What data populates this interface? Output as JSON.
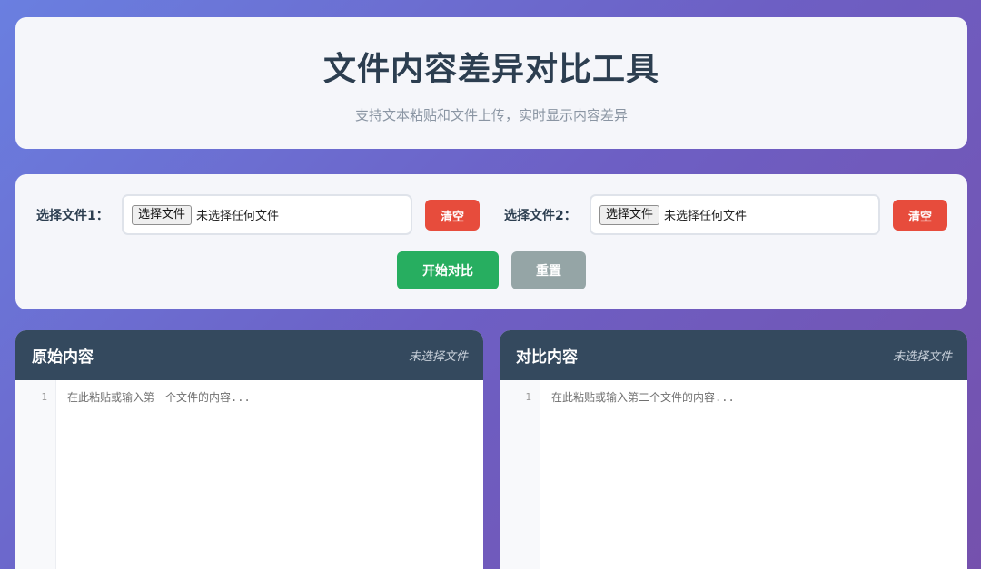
{
  "header": {
    "title": "文件内容差异对比工具",
    "subtitle": "支持文本粘贴和文件上传，实时显示内容差异"
  },
  "controls": {
    "file1": {
      "label": "选择文件1：",
      "button": "选择文件",
      "status": "未选择任何文件",
      "clear": "清空"
    },
    "file2": {
      "label": "选择文件2：",
      "button": "选择文件",
      "status": "未选择任何文件",
      "clear": "清空"
    },
    "start": "开始对比",
    "reset": "重置"
  },
  "panels": {
    "left": {
      "title": "原始内容",
      "file": "未选择文件",
      "line": "1",
      "placeholder": "在此粘贴或输入第一个文件的内容..."
    },
    "right": {
      "title": "对比内容",
      "file": "未选择文件",
      "line": "1",
      "placeholder": "在此粘贴或输入第二个文件的内容..."
    }
  },
  "colors": {
    "primary": "#34495e",
    "danger": "#e74c3c",
    "success": "#27ae60",
    "neutral": "#95a5a6"
  }
}
